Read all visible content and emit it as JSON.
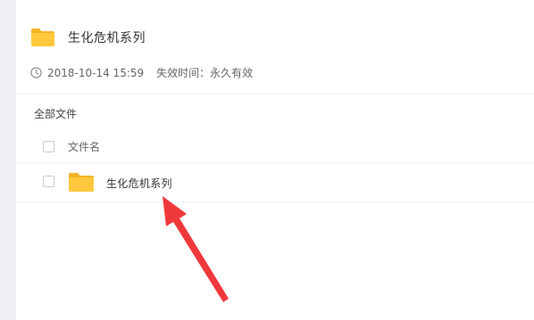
{
  "share": {
    "title": "生化危机系列",
    "date": "2018-10-14 15:59",
    "expire": "失效时间：永久有效"
  },
  "breadcrumb": "全部文件",
  "list": {
    "column_name": "文件名",
    "rows": [
      {
        "name": "生化危机系列",
        "icon": "folder-icon"
      }
    ]
  },
  "colors": {
    "folder": "#ffc83d",
    "folder_tab": "#f5b324",
    "annotation_arrow": "#f0393c",
    "background": "#eef0f4"
  },
  "icons": {
    "clock": "clock-icon",
    "folder": "folder-icon"
  }
}
